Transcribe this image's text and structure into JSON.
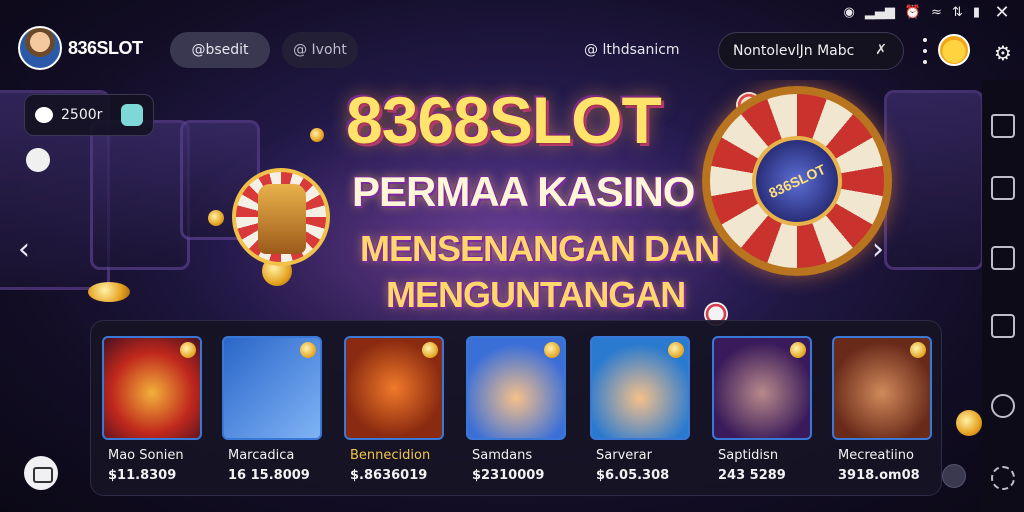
{
  "statusbar": {
    "icons": [
      "record-icon",
      "signal-icon",
      "alarm-icon",
      "wifi-icon",
      "data-icon",
      "battery-icon"
    ],
    "close_icon": "close-icon"
  },
  "header": {
    "brand": "836SLOT",
    "nav": [
      {
        "label": "@bsedit",
        "active": true
      },
      {
        "label": "@ Ivoht",
        "active": false
      }
    ],
    "center_text": "@ lthdsanicm",
    "search": {
      "value": "NontolevlJn Mabc",
      "clear_icon": "close-icon"
    },
    "menu_icon": "kebab-menu-icon",
    "avatar_icon": "user-avatar-icon",
    "settings_icon": "gear-icon"
  },
  "hero": {
    "title": "8368SLOT",
    "line1": "PERMAA KASINO",
    "line2": "MENSENANGAN DAN",
    "line3": "MENGUNTANGAN",
    "wheel_label": "836SLOT",
    "prev_icon": "chevron-left-icon",
    "next_icon": "chevron-right-icon"
  },
  "balance": {
    "amount": "2500r",
    "chat_icon": "speech-bubble-icon",
    "wallet_icon": "wallet-icon"
  },
  "games": [
    {
      "name": "Mao Sonien",
      "price": "$11.8309",
      "thumb": "golden-dragon-wheel"
    },
    {
      "name": "Marcadica",
      "price": "16 15.8009",
      "thumb": "playing-cards"
    },
    {
      "name": "Bennecidion",
      "price": "$.8636019",
      "thumb": "dynamite-stick"
    },
    {
      "name": "Samdans",
      "price": "$2310009",
      "thumb": "firefighter-boy"
    },
    {
      "name": "Sarverar",
      "price": "$6.05.308",
      "thumb": "top-hat-man"
    },
    {
      "name": "Saptidisn",
      "price": "243 5289",
      "thumb": "vampire-man"
    },
    {
      "name": "Mecreatiino",
      "price": "3918.om08",
      "thumb": "pirate-man"
    }
  ],
  "right_rail": [
    "home-icon",
    "square-icon",
    "window-icon",
    "list-icon",
    "circle-icon",
    "gear-icon"
  ],
  "colors": {
    "accent_gold": "#ffd76a",
    "panel": "#161424",
    "thumb_border": "#3a78d8"
  }
}
